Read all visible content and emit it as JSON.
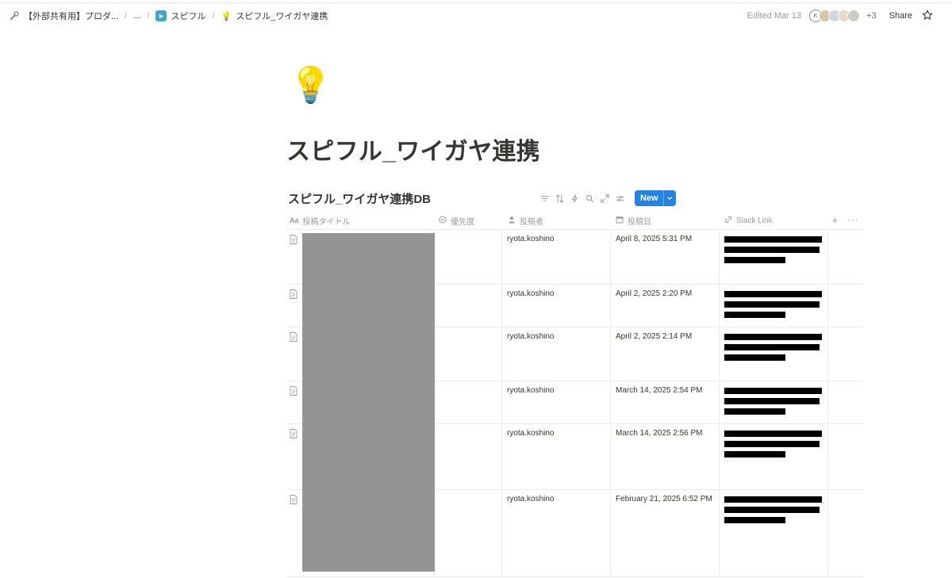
{
  "breadcrumbs": [
    {
      "label": "【外部共有用】プロダ..."
    },
    {
      "label": "..."
    },
    {
      "label": "スピフル"
    },
    {
      "label": "スピフル_ワイガヤ連携"
    }
  ],
  "header": {
    "edited": "Edited Mar 13",
    "avatar_initial": "K",
    "extra_count": "+3",
    "share_label": "Share"
  },
  "page": {
    "icon": "💡",
    "title": "スピフル_ワイガヤ連携"
  },
  "database": {
    "title": "スピフル_ワイガヤ連携DB",
    "new_label": "New",
    "columns": [
      {
        "label": "投稿タイトル",
        "icon": "Aa"
      },
      {
        "label": "優先度",
        "icon": "select-icon"
      },
      {
        "label": "投稿者",
        "icon": "person-icon"
      },
      {
        "label": "投稿日",
        "icon": "calendar-icon"
      },
      {
        "label": "Slack Link",
        "icon": "link-icon"
      }
    ],
    "rows": [
      {
        "author": "ryota.koshino",
        "date": "April 8, 2025 5:31 PM"
      },
      {
        "author": "ryota.koshino",
        "date": "April 2, 2025 2:20 PM"
      },
      {
        "author": "ryota.koshino",
        "date": "April 2, 2025 2:14 PM"
      },
      {
        "author": "ryota.koshino",
        "date": "March 14, 2025 2:54 PM"
      },
      {
        "author": "ryota.koshino",
        "date": "March 14, 2025 2:56 PM"
      },
      {
        "author": "ryota.koshino",
        "date": "February 21, 2025 6:52 PM"
      }
    ]
  },
  "colors": {
    "accent": "#2383e2",
    "text": "#37352f",
    "muted": "#9b9a97",
    "redaction_gray": "#949494"
  }
}
